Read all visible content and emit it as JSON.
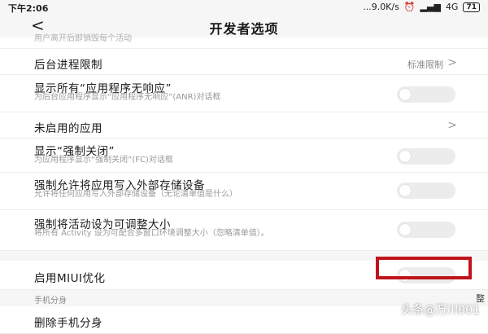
{
  "status_bar": {
    "time": "下午2:06",
    "speed": "...9.0K/s",
    "network": "4G",
    "battery": "71"
  },
  "header": {
    "back": "<",
    "title": "开发者选项"
  },
  "rows": [
    {
      "title": "",
      "desc": "用户离开后即销毁每个活动"
    },
    {
      "title": "后台进程限制",
      "value": "标准限制",
      "chevron": ">"
    },
    {
      "title": "显示所有“应用程序无响应”",
      "desc": "为后台应用程序显示“应用程序无响应”(ANR)对话框",
      "toggle": false
    },
    {
      "title": "未启用的应用",
      "chevron": ">"
    },
    {
      "title": "显示“强制关闭”",
      "desc": "为应用程序显示“强制关闭”(FC)对话框",
      "toggle": false
    },
    {
      "title": "强制允许将应用写入外部存储设备",
      "desc": "允许将任何应用写入外部存储设备（无论清单值是什么）",
      "toggle": false
    },
    {
      "title": "强制将活动设为可调整大小",
      "desc": "将所有 Activity 设为可配合多窗口环境调整大小（忽略清单值）。",
      "toggle": false
    },
    {
      "title": "启用MIUI优化",
      "toggle": false
    },
    {
      "section": "手机分身"
    },
    {
      "title": "删除手机分身"
    }
  ],
  "partial_right_text": "整",
  "watermark": "头条@万川001",
  "colors": {
    "highlight": "#c0141b",
    "toggle_off": "#ececec"
  }
}
